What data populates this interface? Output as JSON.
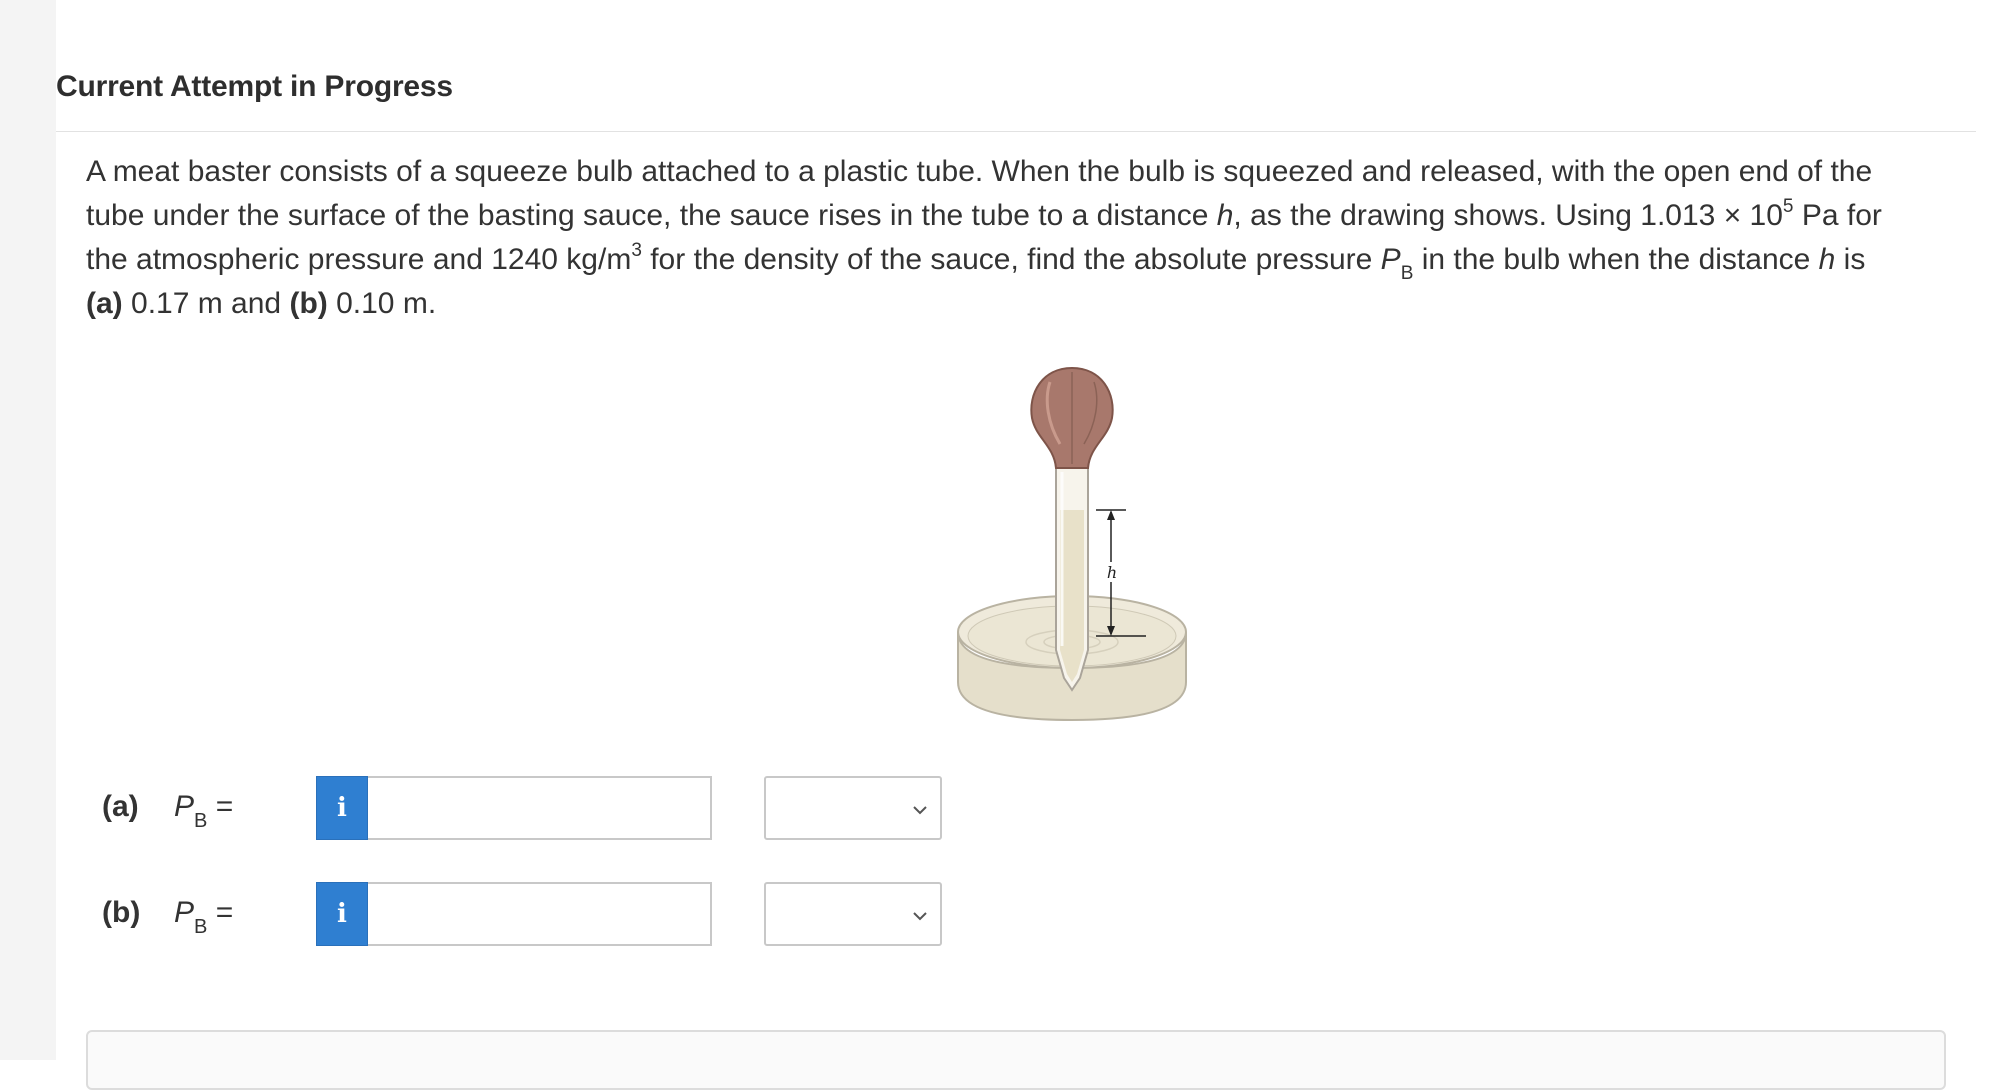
{
  "header": {
    "title": "Current Attempt in Progress"
  },
  "question": {
    "line1": "A meat baster consists of a squeeze bulb attached to a plastic tube. When the bulb is squeezed and released, with the open end of the",
    "line2_a": "tube under the surface of the basting sauce, the sauce rises in the tube to a distance ",
    "h": "h",
    "line2_b": ", as the drawing shows. Using 1.013 × 10",
    "exp5": "5",
    "line2_c": " Pa for",
    "line3_a": "the atmospheric pressure and 1240 kg/m",
    "exp3": "3",
    "line3_b": " for the density of the sauce, find the absolute pressure ",
    "pvar": "P",
    "psub": "B",
    "line3_c": " in the bulb when the distance ",
    "line3_d": " is",
    "part_a_label": "(a)",
    "part_a_text": " 0.17 m and ",
    "part_b_label": "(b)",
    "part_b_text": " 0.10 m."
  },
  "figure": {
    "h_label": "h",
    "colors": {
      "bulb": "#a8786c",
      "tube": "#f3eee2",
      "sauce": "#e9e3cf",
      "dish": "#e5dfcb"
    }
  },
  "answers": [
    {
      "part": "(a)",
      "var": "P",
      "sub": "B",
      "eq": " =",
      "info_icon": "i",
      "value": "",
      "unit": ""
    },
    {
      "part": "(b)",
      "var": "P",
      "sub": "B",
      "eq": " =",
      "info_icon": "i",
      "value": "",
      "unit": ""
    }
  ],
  "icons": {
    "info": "info-icon",
    "dropdown": "chevron-down-icon"
  },
  "colors": {
    "info_button": "#2f7fd1",
    "border": "#c8c8c8"
  }
}
